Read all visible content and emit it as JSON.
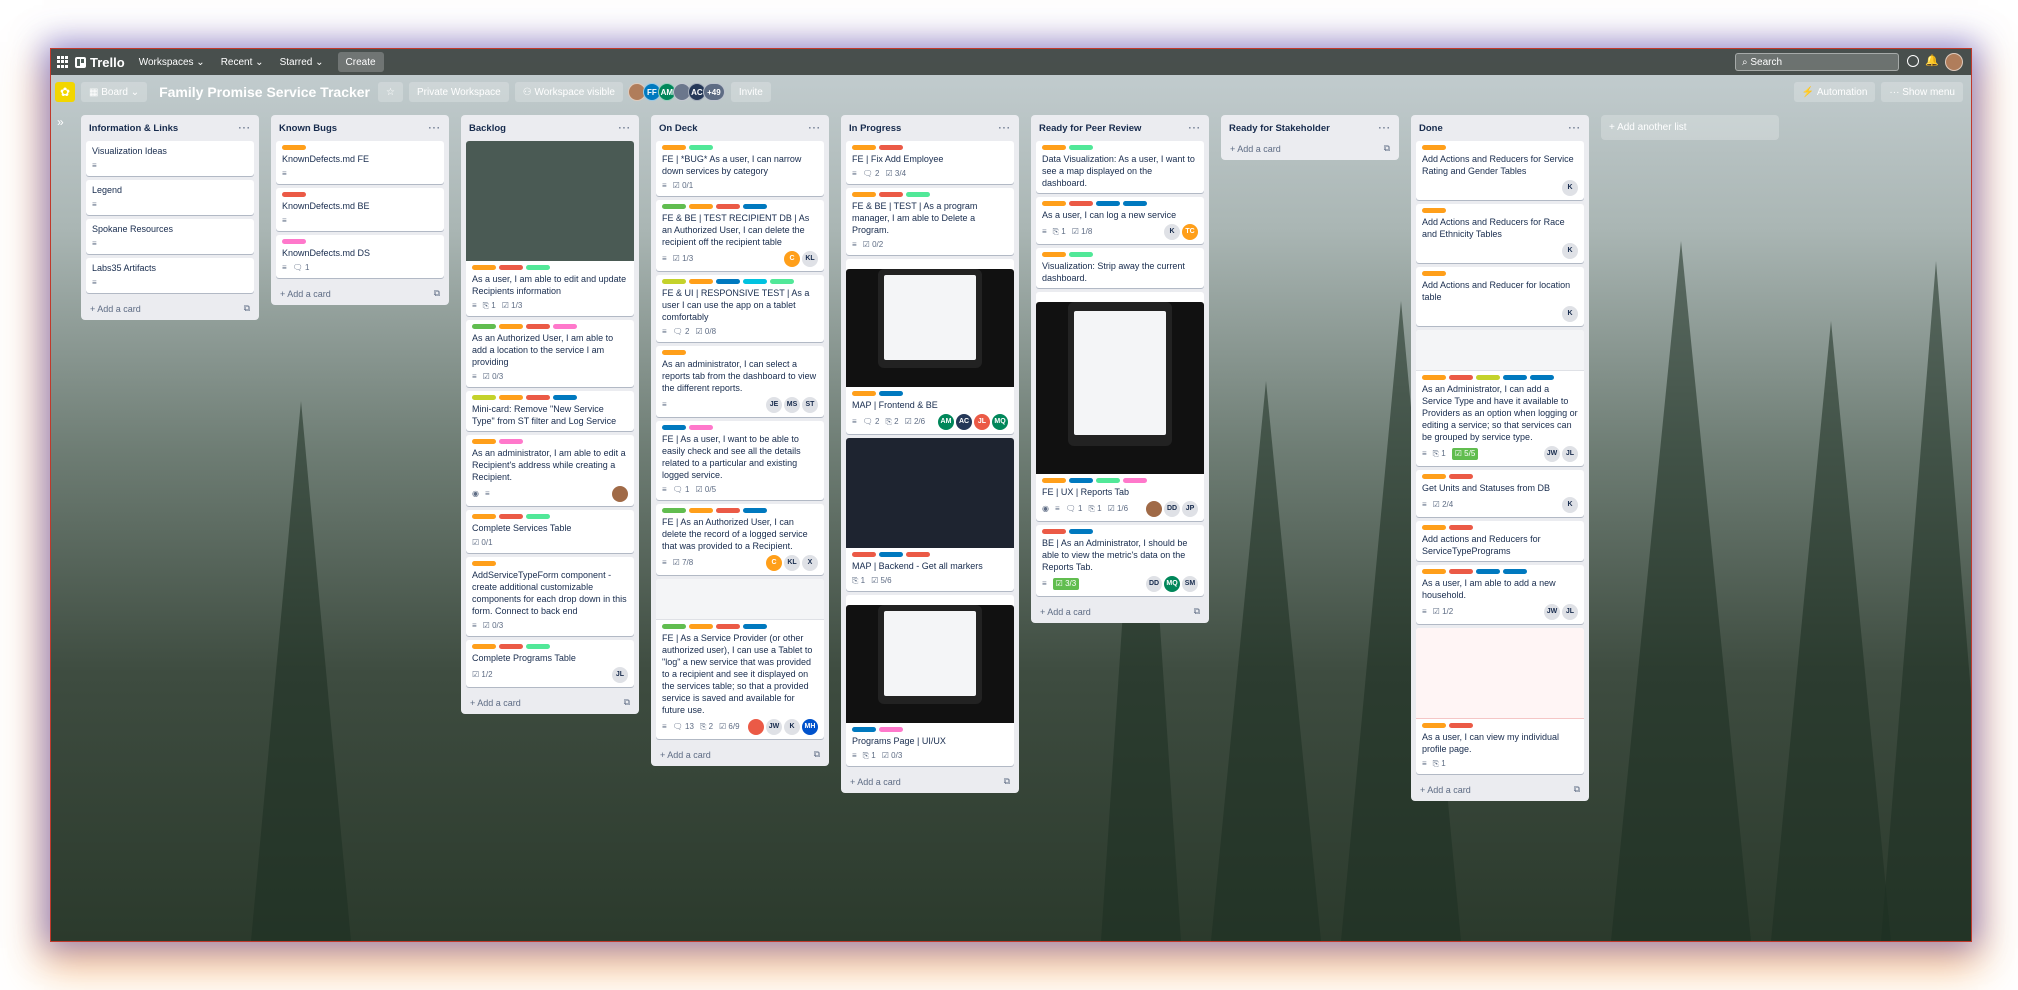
{
  "topbar": {
    "app_name": "Trello",
    "workspaces": "Workspaces",
    "recent": "Recent",
    "starred": "Starred",
    "create": "Create",
    "search_placeholder": "Search"
  },
  "boardbar": {
    "view": "Board",
    "title": "Family Promise Service Tracker",
    "workspace_type": "Private Workspace",
    "visibility": "Workspace visible",
    "members": [
      {
        "initials": "",
        "color": "#b07d5b"
      },
      {
        "initials": "FF",
        "color": "#0079bf"
      },
      {
        "initials": "AM",
        "color": "#00875a"
      },
      {
        "initials": "",
        "color": "#6b778c"
      },
      {
        "initials": "AC",
        "color": "#253858"
      }
    ],
    "more_members": "+49",
    "invite": "Invite",
    "automation": "Automation",
    "show_menu": "Show menu"
  },
  "add_card_label": "Add a card",
  "add_list_label": "Add another list",
  "lists": [
    {
      "name": "Information & Links",
      "cards": [
        {
          "title": "Visualization Ideas",
          "labels": [],
          "badges": [
            "desc"
          ]
        },
        {
          "title": "Legend",
          "labels": [],
          "badges": [
            "desc"
          ]
        },
        {
          "title": "Spokane Resources",
          "labels": [],
          "badges": [
            "desc"
          ]
        },
        {
          "title": "Labs35 Artifacts",
          "labels": [],
          "badges": [
            "desc"
          ]
        }
      ]
    },
    {
      "name": "Known Bugs",
      "cards": [
        {
          "title": "KnownDefects.md FE",
          "labels": [
            "#ff9f1a"
          ],
          "badges": [
            "desc"
          ]
        },
        {
          "title": "KnownDefects.md BE",
          "labels": [
            "#eb5a46"
          ],
          "badges": [
            "desc"
          ]
        },
        {
          "title": "KnownDefects.md DS",
          "labels": [
            "#ff78cb"
          ],
          "badges": [
            "desc",
            "c:1"
          ]
        }
      ]
    },
    {
      "name": "Backlog",
      "cards": [
        {
          "title": "As a user, I am able to edit and update Recipients information",
          "cover": "screen",
          "labels": [
            "#ff9f1a",
            "#eb5a46",
            "#51e898"
          ],
          "badges": [
            "desc",
            "a:1",
            "k:1/3"
          ]
        },
        {
          "title": "As an Authorized User, I am able to add a location to the service I am providing",
          "labels": [
            "#61bd4f",
            "#ff9f1a",
            "#eb5a46",
            "#ff78cb"
          ],
          "badges": [
            "desc",
            "k:0/3"
          ]
        },
        {
          "title": "Mini-card: Remove \"New Service Type\" from ST filter and Log Service",
          "labels": [
            "#c4d22b",
            "#ff9f1a",
            "#eb5a46",
            "#0079bf"
          ],
          "badges": []
        },
        {
          "title": "As an administrator, I am able to edit a Recipient's address while creating a Recipient.",
          "labels": [
            "#ff9f1a",
            "#ff78cb"
          ],
          "badges": [
            "watch",
            "desc"
          ],
          "members": [
            {
              "t": "",
              "c": "#a06a47"
            }
          ]
        },
        {
          "title": "Complete Services Table",
          "labels": [
            "#ff9f1a",
            "#eb5a46",
            "#51e898"
          ],
          "badges": [
            "k:0/1"
          ]
        },
        {
          "title": "AddServiceTypeForm component - create additional customizable components for each drop down in this form. Connect to back end",
          "labels": [
            "#ff9f1a"
          ],
          "badges": [
            "desc",
            "k:0/3"
          ]
        },
        {
          "title": "Complete Programs Table",
          "labels": [
            "#ff9f1a",
            "#eb5a46",
            "#51e898"
          ],
          "badges": [
            "k:1/2"
          ],
          "members": [
            {
              "t": "JL",
              "c": "#dfe1e6"
            }
          ]
        }
      ]
    },
    {
      "name": "On Deck",
      "cards": [
        {
          "title": "FE | *BUG* As a user, I can narrow down services by category",
          "labels": [
            "#ff9f1a",
            "#51e898"
          ],
          "badges": [
            "desc",
            "k:0/1"
          ]
        },
        {
          "title": "FE & BE | TEST RECIPIENT DB | As an Authorized User, I can delete the recipient off the recipient table",
          "labels": [
            "#61bd4f",
            "#ff9f1a",
            "#eb5a46",
            "#0079bf"
          ],
          "badges": [
            "desc",
            "k:1/3"
          ],
          "members": [
            {
              "t": "C",
              "c": "#ff9f1a"
            },
            {
              "t": "KL",
              "c": "#dfe1e6"
            }
          ]
        },
        {
          "title": "FE & UI | RESPONSIVE TEST | As a user I can use the app on a tablet comfortably",
          "labels": [
            "#c4d22b",
            "#ff9f1a",
            "#0079bf",
            "#00c2e0",
            "#51e898"
          ],
          "badges": [
            "desc",
            "c:2",
            "k:0/8"
          ]
        },
        {
          "title": "As an administrator, I can select a reports tab from the dashboard to view the different reports.",
          "labels": [
            "#ff9f1a"
          ],
          "badges": [
            "desc"
          ],
          "members": [
            {
              "t": "JE",
              "c": "#dfe1e6"
            },
            {
              "t": "MS",
              "c": "#dfe1e6"
            },
            {
              "t": "ST",
              "c": "#dfe1e6"
            }
          ]
        },
        {
          "title": "FE | As a user, I want to be able to easily check and see all the details related to a particular and existing logged service.",
          "labels": [
            "#0079bf",
            "#ff78cb"
          ],
          "badges": [
            "desc",
            "c:1",
            "k:0/5"
          ]
        },
        {
          "title": "FE | As an Authorized User, I can delete the record of a logged service that was provided to a Recipient.",
          "labels": [
            "#61bd4f",
            "#ff9f1a",
            "#eb5a46",
            "#0079bf"
          ],
          "badges": [
            "desc",
            "k:7/8"
          ],
          "members": [
            {
              "t": "C",
              "c": "#ff9f1a"
            },
            {
              "t": "KL",
              "c": "#dfe1e6"
            },
            {
              "t": "X",
              "c": "#dfe1e6"
            }
          ]
        },
        {
          "title": "FE | As a Service Provider (or other authorized user), I can use a Tablet to \"log\" a new service that was provided to a recipient and see it displayed on the services table; so that a provided service is saved and available for future use.",
          "cover": "light",
          "labels": [
            "#61bd4f",
            "#ff9f1a",
            "#eb5a46",
            "#0079bf"
          ],
          "badges": [
            "desc",
            "c:13",
            "a:2",
            "k:6/9"
          ],
          "members": [
            {
              "t": "",
              "c": "#eb5a46"
            },
            {
              "t": "JW",
              "c": "#dfe1e6"
            },
            {
              "t": "K",
              "c": "#dfe1e6"
            },
            {
              "t": "MH",
              "c": "#0052cc"
            }
          ]
        }
      ]
    },
    {
      "name": "In Progress",
      "cards": [
        {
          "title": "FE | Fix Add Employee",
          "labels": [
            "#ff9f1a",
            "#eb5a46"
          ],
          "badges": [
            "desc",
            "c:2",
            "k:3/4"
          ]
        },
        {
          "title": "FE & BE | TEST | As a program manager, I am able to Delete a Program.",
          "labels": [
            "#ff9f1a",
            "#eb5a46",
            "#51e898"
          ],
          "badges": [
            "desc",
            "k:0/2"
          ]
        },
        {
          "title": "MAP | Frontend & BE",
          "cover": "tablet-dark",
          "labels": [
            "#ff9f1a",
            "#0079bf"
          ],
          "badges": [
            "desc",
            "c:2",
            "a:2",
            "k:2/6"
          ],
          "members": [
            {
              "t": "AM",
              "c": "#00875a"
            },
            {
              "t": "AC",
              "c": "#253858"
            },
            {
              "t": "JL",
              "c": "#eb5a46"
            },
            {
              "t": "MQ",
              "c": "#00875a"
            }
          ]
        },
        {
          "title": "MAP | Backend - Get all markers",
          "cover": "code",
          "labels": [
            "#eb5a46",
            "#0079bf",
            "#eb5a46"
          ],
          "badges": [
            "a:1",
            "k:5/6"
          ]
        },
        {
          "title": "Programs Page | UI/UX",
          "cover": "tablet-dark",
          "labels": [
            "#0079bf",
            "#ff78cb"
          ],
          "badges": [
            "desc",
            "a:1",
            "k:0/3"
          ]
        }
      ]
    },
    {
      "name": "Ready for Peer Review",
      "cards": [
        {
          "title": "Data Visualization: As a user, I want to see a map displayed on the dashboard.",
          "labels": [
            "#ff9f1a",
            "#51e898"
          ],
          "badges": []
        },
        {
          "title": "As a user, I can log a new service",
          "labels": [
            "#ff9f1a",
            "#eb5a46",
            "#0079bf",
            "#0079bf"
          ],
          "badges": [
            "desc",
            "a:1",
            "k:1/8"
          ],
          "members": [
            {
              "t": "K",
              "c": "#dfe1e6"
            },
            {
              "t": "TC",
              "c": "#ff9f1a"
            }
          ]
        },
        {
          "title": "Visualization: Strip away the current dashboard.",
          "labels": [
            "#ff9f1a",
            "#51e898"
          ],
          "badges": []
        },
        {
          "title": "FE | UX | Reports Tab",
          "cover": "tablet-chart",
          "labels": [
            "#ff9f1a",
            "#0079bf",
            "#51e898",
            "#ff78cb"
          ],
          "badges": [
            "watch",
            "desc",
            "c:1",
            "a:1",
            "k:1/6"
          ],
          "members": [
            {
              "t": "",
              "c": "#a06a47"
            },
            {
              "t": "DD",
              "c": "#dfe1e6"
            },
            {
              "t": "JP",
              "c": "#dfe1e6"
            }
          ]
        },
        {
          "title": "BE | As an Administrator, I should be able to view the metric's data on the Reports Tab.",
          "labels": [
            "#eb5a46",
            "#0079bf"
          ],
          "badges": [
            "desc",
            "done:3/3"
          ],
          "members": [
            {
              "t": "DD",
              "c": "#dfe1e6"
            },
            {
              "t": "MQ",
              "c": "#00875a"
            },
            {
              "t": "SM",
              "c": "#dfe1e6"
            }
          ]
        }
      ]
    },
    {
      "name": "Ready for Stakeholder",
      "cards": []
    },
    {
      "name": "Done",
      "cards": [
        {
          "title": "Add Actions and Reducers for Service Rating and Gender Tables",
          "labels": [
            "#ff9f1a"
          ],
          "badges": [],
          "members": [
            {
              "t": "K",
              "c": "#dfe1e6"
            }
          ]
        },
        {
          "title": "Add Actions and Reducers for Race and Ethnicity Tables",
          "labels": [
            "#ff9f1a"
          ],
          "badges": [],
          "members": [
            {
              "t": "K",
              "c": "#dfe1e6"
            }
          ]
        },
        {
          "title": "Add Actions and Reducer for location table",
          "labels": [
            "#ff9f1a"
          ],
          "badges": [],
          "members": [
            {
              "t": "K",
              "c": "#dfe1e6"
            }
          ]
        },
        {
          "title": "As an Administrator, I can add a Service Type and have it available to Providers as an option when logging or editing a service; so that services can be grouped by service type.",
          "cover": "light",
          "labels": [
            "#ff9f1a",
            "#eb5a46",
            "#c4d22b",
            "#0079bf",
            "#0079bf"
          ],
          "badges": [
            "desc",
            "a:1",
            "done:5/5"
          ],
          "members": [
            {
              "t": "JW",
              "c": "#dfe1e6"
            },
            {
              "t": "JL",
              "c": "#dfe1e6"
            }
          ]
        },
        {
          "title": "Get Units and Statuses from DB",
          "labels": [
            "#ff9f1a",
            "#eb5a46"
          ],
          "badges": [
            "desc",
            "k:2/4"
          ],
          "members": [
            {
              "t": "K",
              "c": "#dfe1e6"
            }
          ]
        },
        {
          "title": "Add actions and Reducers for ServiceTypePrograms",
          "labels": [
            "#ff9f1a",
            "#eb5a46"
          ],
          "badges": []
        },
        {
          "title": "As a user, I am able to add a new household.",
          "labels": [
            "#ff9f1a",
            "#eb5a46",
            "#0079bf",
            "#0079bf"
          ],
          "badges": [
            "desc",
            "k:1/2"
          ],
          "members": [
            {
              "t": "JW",
              "c": "#dfe1e6"
            },
            {
              "t": "JL",
              "c": "#dfe1e6"
            }
          ]
        },
        {
          "title": "As a user, I can view my individual profile page.",
          "cover": "error",
          "labels": [
            "#ff9f1a",
            "#eb5a46"
          ],
          "badges": [
            "desc",
            "a:1"
          ]
        }
      ]
    }
  ]
}
